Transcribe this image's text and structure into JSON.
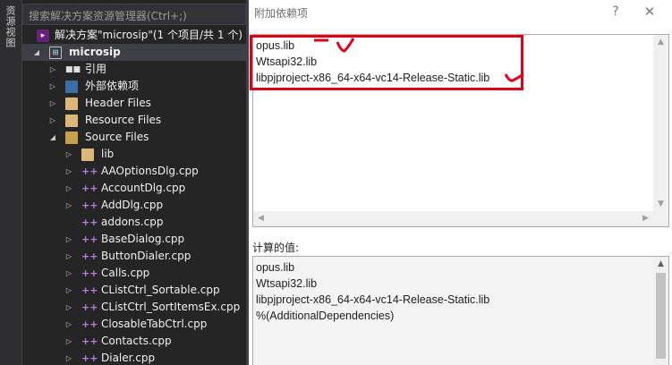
{
  "sidebar_tab": {
    "label": "资源视图"
  },
  "explorer": {
    "search_placeholder": "搜索解决方案资源管理器(Ctrl+;)",
    "solution_label": "解决方案\"microsip\"(1 个项目/共 1 个)",
    "project_label": "microsip",
    "references_label": "引用",
    "external_deps_label": "外部依赖项",
    "header_files_label": "Header Files",
    "resource_files_label": "Resource Files",
    "source_files_label": "Source Files",
    "lib_label": "lib",
    "files": [
      "AAOptionsDlg.cpp",
      "AccountDlg.cpp",
      "AddDlg.cpp",
      "addons.cpp",
      "BaseDialog.cpp",
      "ButtonDialer.cpp",
      "Calls.cpp",
      "CListCtrl_Sortable.cpp",
      "CListCtrl_SortItemsEx.cpp",
      "ClosableTabCtrl.cpp",
      "Contacts.cpp",
      "Dialer.cpp"
    ]
  },
  "dialog": {
    "title": "附加依赖项",
    "help_label": "?",
    "close_label": "✕",
    "dependencies": [
      "opus.lib",
      "Wtsapi32.lib",
      "libpjproject-x86_64-x64-vc14-Release-Static.lib"
    ],
    "computed_label": "计算的值:",
    "computed_values": [
      "opus.lib",
      "Wtsapi32.lib",
      "libpjproject-x86_64-x64-vc14-Release-Static.lib",
      "%(AdditionalDependencies)"
    ]
  },
  "colors": {
    "annotation_red": "#e00018",
    "ide_background": "#252526",
    "selection": "#3f3f46"
  }
}
